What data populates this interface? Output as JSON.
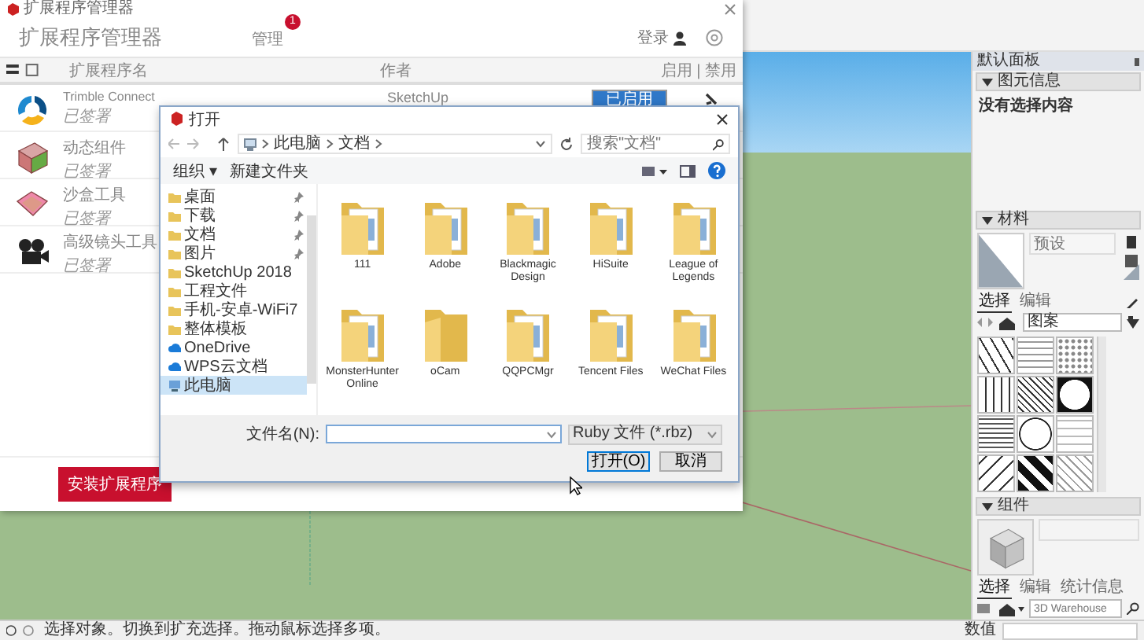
{
  "extension_manager": {
    "title": "扩展程序管理器",
    "heading": "扩展程序管理器",
    "tabs": [
      {
        "label": "管理",
        "selected": false,
        "badge": "1"
      }
    ],
    "login": "登录",
    "columns": [
      "扩展程序名",
      "作者",
      "启用 | 禁用"
    ],
    "extensions": [
      {
        "name": "Trimble Connect",
        "status": "已签署",
        "author": "SketchUp",
        "toggle": {
          "label": "已启用",
          "enabled": true
        },
        "kind": "connect"
      },
      {
        "name": "动态组件",
        "status": "已签署",
        "kind": "dynamic"
      },
      {
        "name": "沙盒工具",
        "status": "已签署",
        "kind": "sandbox"
      },
      {
        "name": "高级镜头工具",
        "status": "已签署",
        "kind": "camera"
      }
    ],
    "install_button": "安装扩展程序"
  },
  "open_dialog": {
    "title": "打开",
    "breadcrumb": [
      "此电脑",
      "文档"
    ],
    "search_placeholder": "搜索\"文档\"",
    "organize": "组织 ▾",
    "new_folder": "新建文件夹",
    "sidebar": [
      {
        "label": "桌面",
        "kind": "folder",
        "pinned": true,
        "selected": false
      },
      {
        "label": "下载",
        "kind": "folder",
        "pinned": true,
        "selected": false
      },
      {
        "label": "文档",
        "kind": "folder",
        "pinned": true,
        "selected": false
      },
      {
        "label": "图片",
        "kind": "folder",
        "pinned": true,
        "selected": false
      },
      {
        "label": "SketchUp 2018",
        "kind": "folder",
        "pinned": false,
        "selected": false
      },
      {
        "label": "工程文件",
        "kind": "folder",
        "pinned": false,
        "selected": false
      },
      {
        "label": "手机-安卓-WiFi7",
        "kind": "folder",
        "pinned": false,
        "selected": false
      },
      {
        "label": "整体模板",
        "kind": "folder",
        "pinned": false,
        "selected": false
      },
      {
        "label": "OneDrive",
        "kind": "cloud",
        "pinned": false,
        "selected": false
      },
      {
        "label": "WPS云文档",
        "kind": "cloud",
        "pinned": false,
        "selected": false
      },
      {
        "label": "此电脑",
        "kind": "computer",
        "pinned": false,
        "selected": true
      }
    ],
    "folders": [
      {
        "name": "111",
        "kind": "full"
      },
      {
        "name": "Adobe",
        "kind": "full"
      },
      {
        "name": "Blackmagic Design",
        "kind": "full"
      },
      {
        "name": "HiSuite",
        "kind": "full"
      },
      {
        "name": "League of Legends",
        "kind": "full"
      },
      {
        "name": "MonsterHunter Online",
        "kind": "full"
      },
      {
        "name": "oCam",
        "kind": "empty"
      },
      {
        "name": "QQPCMgr",
        "kind": "full"
      },
      {
        "name": "Tencent Files",
        "kind": "full"
      },
      {
        "name": "WeChat Files",
        "kind": "full"
      }
    ],
    "filename_label": "文件名(N):",
    "filetype": "Ruby 文件 (*.rbz)",
    "open_button": "打开(O)",
    "cancel_button": "取消"
  },
  "tray": {
    "title": "默认面板",
    "entity_info": {
      "title": "图元信息",
      "expanded": true,
      "text": "没有选择内容"
    },
    "materials": {
      "title": "材料",
      "expanded": true,
      "name_placeholder": "预设",
      "tabs": [
        {
          "label": "选择",
          "selected": true
        },
        {
          "label": "编辑",
          "selected": false
        }
      ],
      "library": "图案"
    },
    "components": {
      "title": "组件",
      "expanded": true,
      "tabs": [
        {
          "label": "选择",
          "selected": true
        },
        {
          "label": "编辑",
          "selected": false
        },
        {
          "label": "统计信息",
          "selected": false
        }
      ],
      "search_placeholder": "3D Warehouse"
    }
  },
  "status_bar": {
    "text": "选择对象。切换到扩充选择。拖动鼠标选择多项。",
    "measurement_label": "数值"
  }
}
